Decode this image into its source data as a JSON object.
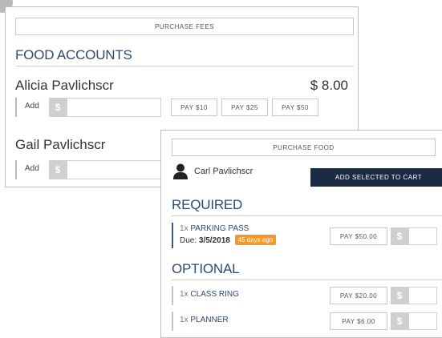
{
  "fees_panel": {
    "purchase_fees_label": "PURCHASE FEES",
    "section_title": "FOOD ACCOUNTS",
    "accounts": [
      {
        "name": "Alicia Pavlichscr",
        "balance": "$ 8.00",
        "add_label": "Add",
        "dollar_symbol": "$",
        "quick_pay": [
          "PAY $10",
          "PAY $25",
          "PAY $50"
        ]
      },
      {
        "name": "Gail Pavlichscr",
        "add_label": "Add",
        "dollar_symbol": "$"
      }
    ]
  },
  "food_panel": {
    "purchase_food_label": "PURCHASE FOOD",
    "student_name": "Carl Pavlichscr",
    "add_to_cart_label": "ADD SELECTED TO CART",
    "required_title": "REQUIRED",
    "optional_title": "OPTIONAL",
    "required_items": [
      {
        "qty": "1x",
        "name": "PARKING PASS",
        "due_label": "Due:",
        "due_date": "3/5/2018",
        "overdue_badge": "45 days ago",
        "pay_label": "PAY $50.00",
        "dollar_symbol": "$"
      }
    ],
    "optional_items": [
      {
        "qty": "1x",
        "name": "CLASS RING",
        "pay_label": "PAY $20.00",
        "dollar_symbol": "$"
      },
      {
        "qty": "1x",
        "name": "PLANNER",
        "pay_label": "PAY $6.00",
        "dollar_symbol": "$"
      }
    ]
  },
  "colors": {
    "accent_navy": "#1b2b44",
    "title_blue": "#2c4a73",
    "overdue_orange": "#ef9a2b"
  },
  "icons": [
    "user-avatar-icon"
  ]
}
